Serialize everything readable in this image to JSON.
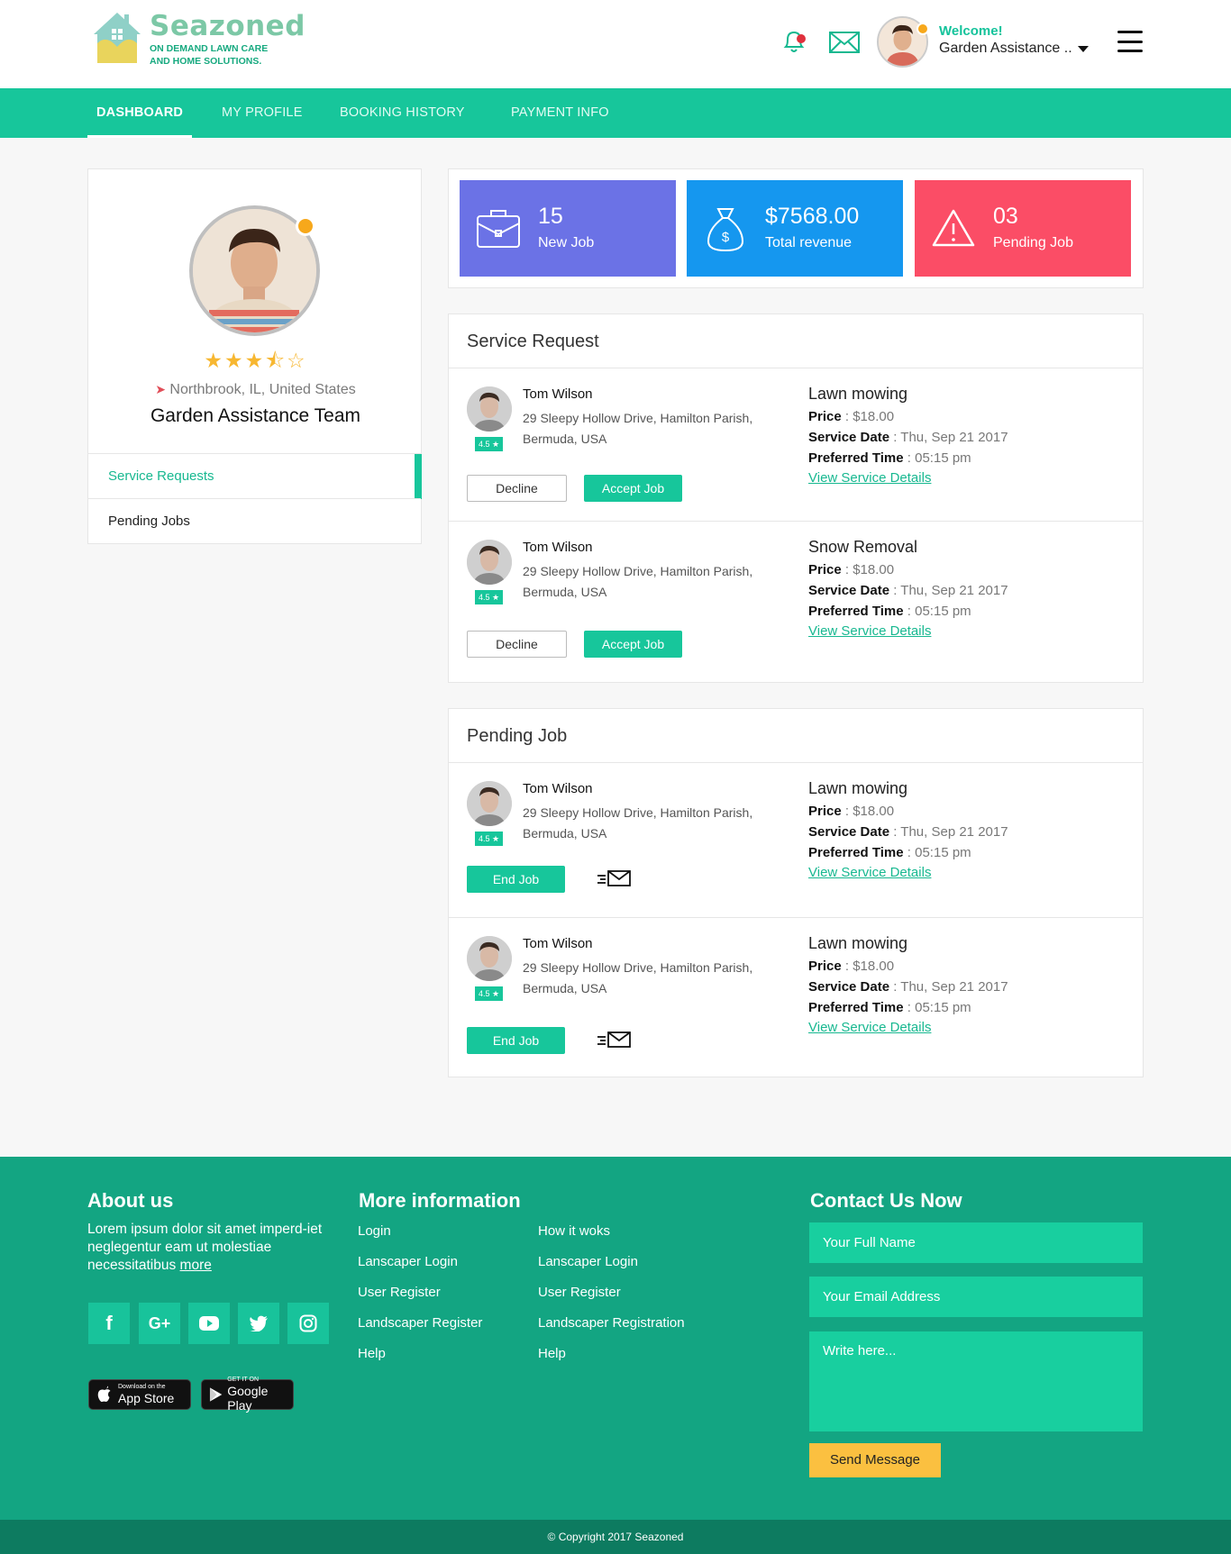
{
  "header": {
    "logo": {
      "name": "Seazoned",
      "tagline_1": "ON DEMAND LAWN CARE",
      "tagline_2": "AND HOME SOLUTIONS."
    },
    "welcome": "Welcome!",
    "user_name": "Garden Assistance ..",
    "icons": [
      "bell-icon",
      "mail-icon",
      "avatar",
      "caret-down-icon",
      "hamburger-icon"
    ]
  },
  "nav": {
    "items": [
      "DASHBOARD",
      "MY PROFILE",
      "BOOKING HISTORY",
      "PAYMENT INFO"
    ],
    "active": "DASHBOARD"
  },
  "profile": {
    "rating": 3.5,
    "stars_text": "★★★⯪☆",
    "location": "Northbrook, IL, United States",
    "team": "Garden Assistance Team",
    "menu": [
      "Service Requests",
      "Pending Jobs"
    ],
    "active_menu": "Service Requests"
  },
  "stats": [
    {
      "value": "15",
      "label": "New Job",
      "color": "#6b72e6",
      "icon": "briefcase-icon"
    },
    {
      "value": "$7568.00",
      "label": "Total revenue",
      "color": "#1597ef",
      "icon": "money-bag-icon"
    },
    {
      "value": "03",
      "label": "Pending Job",
      "color": "#fb4d66",
      "icon": "warning-icon"
    }
  ],
  "service_request": {
    "title": "Service Request",
    "jobs": [
      {
        "name": "Tom Wilson",
        "address": "29 Sleepy Hollow Drive, Hamilton Parish, Bermuda, USA",
        "rating": "4.5",
        "service": "Lawn mowing",
        "price_label": "Price",
        "price": "$18.00",
        "date_label": "Service Date",
        "date": "Thu, Sep 21 2017",
        "time_label": "Preferred Time",
        "time": "05:15 pm",
        "link": "View Service Details",
        "decline": "Decline",
        "accept": "Accept Job"
      },
      {
        "name": "Tom Wilson",
        "address": "29 Sleepy Hollow Drive, Hamilton Parish, Bermuda, USA",
        "rating": "4.5",
        "service": "Snow Removal",
        "price_label": "Price",
        "price": "$18.00",
        "date_label": "Service Date",
        "date": "Thu, Sep 21 2017",
        "time_label": "Preferred Time",
        "time": "05:15 pm",
        "link": "View Service Details",
        "decline": "Decline",
        "accept": "Accept Job"
      }
    ]
  },
  "pending_job": {
    "title": "Pending Job",
    "jobs": [
      {
        "name": "Tom Wilson",
        "address": "29 Sleepy Hollow Drive, Hamilton Parish, Bermuda, USA",
        "rating": "4.5",
        "service": "Lawn mowing",
        "price_label": "Price",
        "price": "$18.00",
        "date_label": "Service Date",
        "date": "Thu, Sep 21 2017",
        "time_label": "Preferred Time",
        "time": "05:15 pm",
        "link": "View Service Details",
        "end": "End Job"
      },
      {
        "name": "Tom Wilson",
        "address": "29 Sleepy Hollow Drive, Hamilton Parish, Bermuda, USA",
        "rating": "4.5",
        "service": "Lawn mowing",
        "price_label": "Price",
        "price": "$18.00",
        "date_label": "Service Date",
        "date": "Thu, Sep 21 2017",
        "time_label": "Preferred Time",
        "time": "05:15 pm",
        "link": "View Service Details",
        "end": "End Job"
      }
    ]
  },
  "footer": {
    "about_title": "About us",
    "about_text": "Lorem ipsum dolor sit amet imperd-iet neglegentur eam ut molestiae necessitatibus",
    "about_more": "more",
    "social": [
      "facebook-icon",
      "google-plus-icon",
      "youtube-icon",
      "twitter-icon",
      "instagram-icon"
    ],
    "app_store_small": "Download on the",
    "app_store_big": "App Store",
    "google_play_small": "GET IT ON",
    "google_play_big": "Google Play",
    "more_title": "More information",
    "links_col1": [
      "Login",
      "Lanscaper Login",
      "User Register",
      "Landscaper Register",
      "Help"
    ],
    "links_col2": [
      "How it woks",
      "Lanscaper Login",
      "User Register",
      "Landscaper Registration",
      "Help"
    ],
    "contact_title": "Contact Us Now",
    "name_placeholder": "Your Full Name",
    "email_placeholder": "Your Email Address",
    "message_placeholder": "Write here...",
    "send": "Send Message",
    "copyright": "© Copyright 2017 Seazoned"
  },
  "colors": {
    "accent": "#17c69b",
    "footer": "#13a582",
    "copyright_bar": "#0d7b60",
    "send_button": "#fbc040"
  }
}
